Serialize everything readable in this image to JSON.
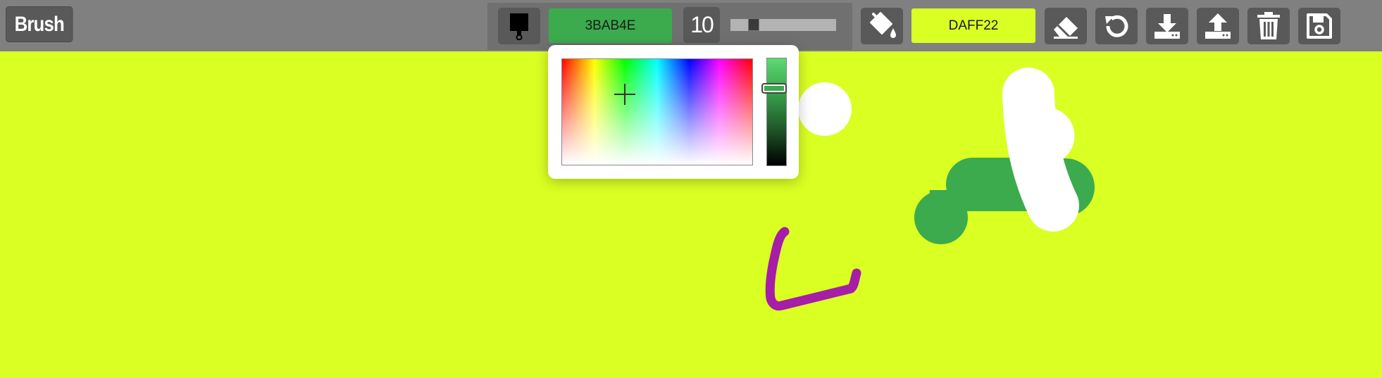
{
  "toolbar": {
    "mode_label": "Brush",
    "brush_color_hex": "3BAB4E",
    "brush_color": "#3BAB4E",
    "brush_size": "10",
    "brush_size_level": 0.19,
    "fill_color_hex": "DAFF22",
    "fill_color": "#DAFF22",
    "icons": [
      "brush-icon",
      "paint-bucket-icon",
      "eraser-icon",
      "undo-icon",
      "download-icon",
      "upload-icon",
      "trash-icon",
      "save-icon"
    ]
  },
  "color_picker": {
    "open": true,
    "selected_hue_position": 0.33,
    "selected_saturation": 0.67,
    "lightness_level": 0.28
  },
  "canvas": {
    "background": "#DAFF22",
    "stroke_colors": [
      "#FFFFFF",
      "#3BAB4E",
      "#A61DA8"
    ]
  }
}
